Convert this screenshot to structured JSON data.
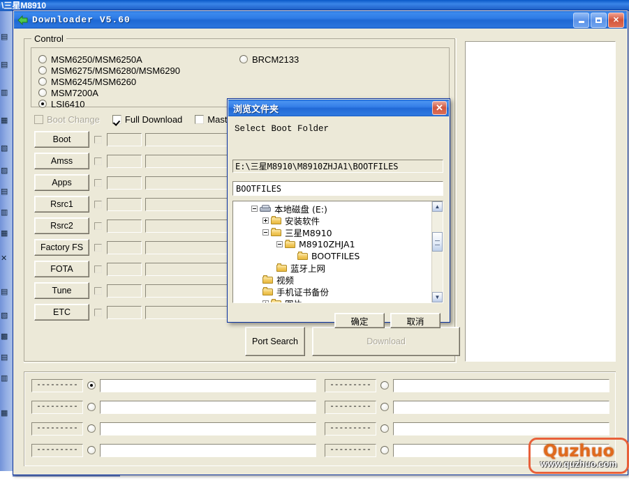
{
  "background_window": {
    "title": "\\三星M8910",
    "sidebar_icons": [
      "document-icon",
      "back-icon",
      "document-icon",
      "folder-icon",
      "device-icon",
      "globe-icon",
      "page-icon",
      "mail-icon",
      "media-icon",
      "close-icon",
      "text-icon",
      "link-icon",
      "box-icon",
      "lock-icon",
      "user-icon",
      "printer-icon",
      "music-icon"
    ]
  },
  "app": {
    "title": "Downloader V5.60",
    "icon": "green-arrow-icon",
    "window_buttons": {
      "minimize": "minimize-icon",
      "maximize": "maximize-icon",
      "close": "✕"
    }
  },
  "control": {
    "legend": "Control",
    "chips": [
      {
        "label": "MSM6250/MSM6250A",
        "selected": false
      },
      {
        "label": "MSM6275/MSM6280/MSM6290",
        "selected": false
      },
      {
        "label": "MSM6245/MSM6260",
        "selected": false
      },
      {
        "label": "MSM7200A",
        "selected": false
      },
      {
        "label": "LSI6410",
        "selected": true
      },
      {
        "label": "BRCM2133",
        "selected": false
      }
    ],
    "checkboxes": [
      {
        "label": "Boot Change",
        "checked": false,
        "disabled": true
      },
      {
        "label": "Full Download",
        "checked": true,
        "disabled": false
      },
      {
        "label": "Master Ro",
        "checked": false,
        "disabled": false
      }
    ],
    "file_rows": [
      {
        "button": "Boot",
        "checked": false,
        "size": "",
        "path": ""
      },
      {
        "button": "Amss",
        "checked": false,
        "size": "",
        "path": ""
      },
      {
        "button": "Apps",
        "checked": false,
        "size": "",
        "path": ""
      },
      {
        "button": "Rsrc1",
        "checked": false,
        "size": "",
        "path": ""
      },
      {
        "button": "Rsrc2",
        "checked": false,
        "size": "",
        "path": ""
      },
      {
        "button": "Factory FS",
        "checked": false,
        "size": "",
        "path": ""
      },
      {
        "button": "FOTA",
        "checked": false,
        "size": "",
        "path": ""
      },
      {
        "button": "Tune",
        "checked": false,
        "size": "",
        "path": ""
      },
      {
        "button": "ETC",
        "checked": false,
        "size": "",
        "path": ""
      }
    ],
    "port_search_label": "Port Search",
    "download_label": "Download",
    "download_disabled": true
  },
  "log_panel": {
    "text": ""
  },
  "ports": {
    "rows": [
      {
        "dash": "---------",
        "selected": true,
        "value": ""
      },
      {
        "dash": "---------",
        "selected": false,
        "value": ""
      },
      {
        "dash": "---------",
        "selected": false,
        "value": ""
      },
      {
        "dash": "---------",
        "selected": false,
        "value": ""
      },
      {
        "dash": "---------",
        "selected": false,
        "value": ""
      },
      {
        "dash": "---------",
        "selected": false,
        "value": ""
      },
      {
        "dash": "---------",
        "selected": false,
        "value": ""
      },
      {
        "dash": "---------",
        "selected": false,
        "value": ""
      }
    ]
  },
  "browse_dialog": {
    "title": "浏览文件夹",
    "close_glyph": "✕",
    "prompt": "Select Boot Folder",
    "path_value": "E:\\三星M8910\\M8910ZHJA1\\BOOTFILES",
    "name_value": "BOOTFILES",
    "tree": [
      {
        "label": "本地磁盘 (E:)",
        "indent": 0,
        "icon": "drive-icon",
        "expander": "minus"
      },
      {
        "label": "安装软件",
        "indent": 1,
        "icon": "folder-icon",
        "expander": "plus"
      },
      {
        "label": "三星M8910",
        "indent": 1,
        "icon": "folder-icon",
        "expander": "minus"
      },
      {
        "label": "M8910ZHJA1",
        "indent": 2,
        "icon": "folder-icon",
        "expander": "minus"
      },
      {
        "label": "BOOTFILES",
        "indent": 3,
        "icon": "folder-icon",
        "expander": "none"
      },
      {
        "label": "蓝牙上网",
        "indent": 2,
        "icon": "folder-icon",
        "expander": "none"
      },
      {
        "label": "视频",
        "indent": 1,
        "icon": "folder-icon",
        "expander": "none"
      },
      {
        "label": "手机证书备份",
        "indent": 1,
        "icon": "folder-icon",
        "expander": "none"
      },
      {
        "label": "图片",
        "indent": 1,
        "icon": "folder-icon",
        "expander": "plus"
      }
    ],
    "scroll": {
      "up": "▲",
      "down": "▼"
    },
    "ok_label": "确定",
    "cancel_label": "取消"
  },
  "watermark": {
    "name": "Quzhuo",
    "url": "www.quzhuo.com",
    "color": "#e06a1e"
  },
  "colors": {
    "face": "#ece9d8",
    "title_blue": "#2f7ce6",
    "accent_orange": "#e06a1e",
    "close_red": "#cf5740"
  }
}
